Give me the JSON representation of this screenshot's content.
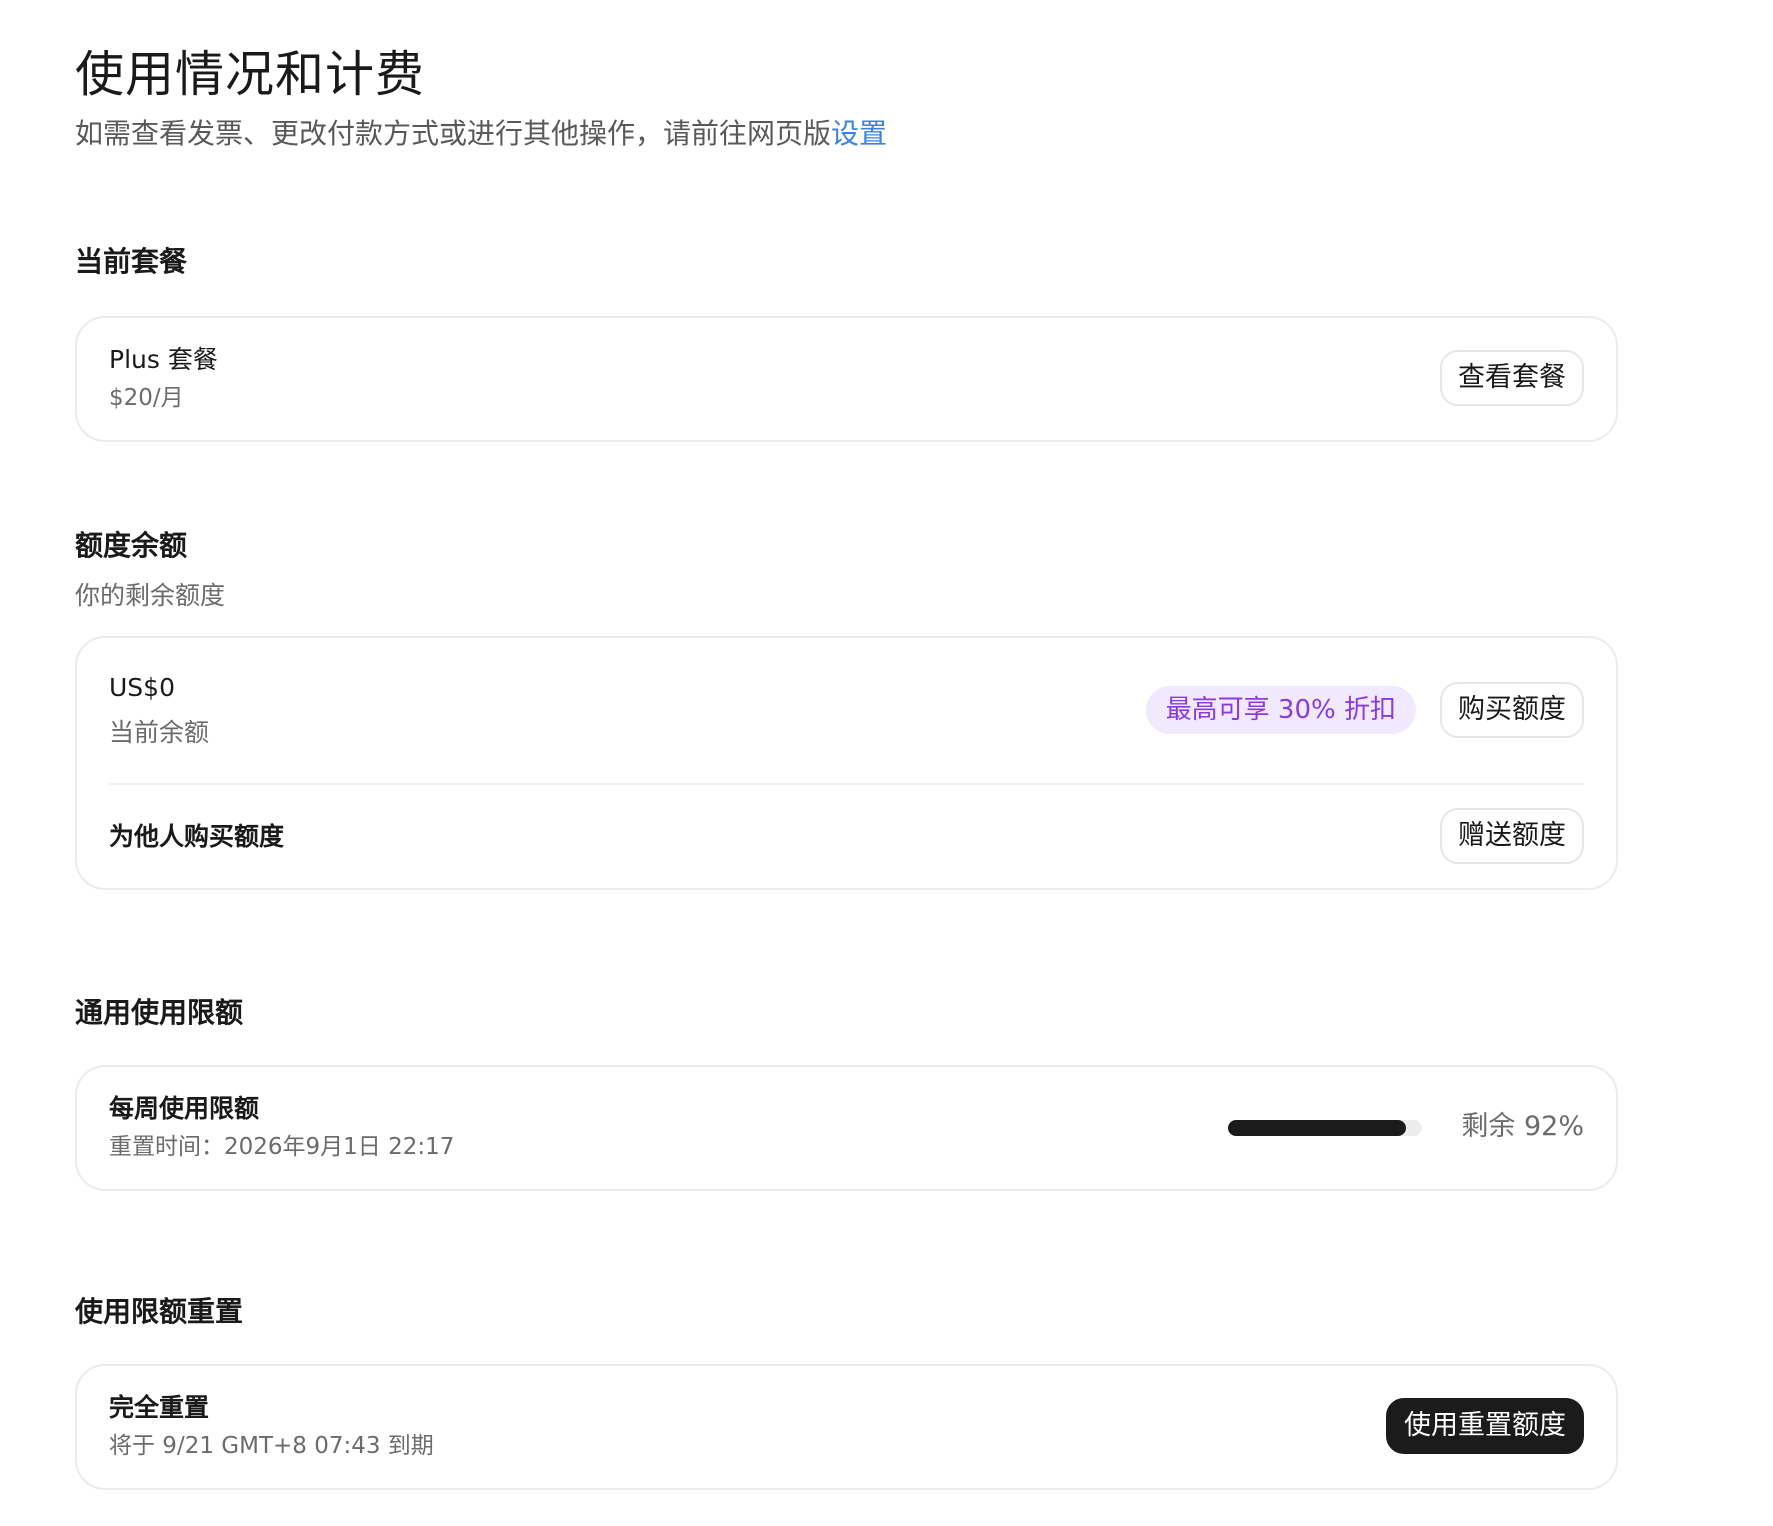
{
  "header": {
    "title": "使用情况和计费",
    "subtitle_prefix": "如需查看发票、更改付款方式或进行其他操作，请前往网页版",
    "subtitle_link": "设置"
  },
  "current_plan": {
    "section_title": "当前套餐",
    "plan_name": "Plus 套餐",
    "plan_price": "$20/月",
    "view_plans_button": "查看套餐"
  },
  "credit_balance": {
    "section_title": "额度余额",
    "section_desc": "你的剩余额度",
    "amount": "US$0",
    "amount_label": "当前余额",
    "discount_badge": "最高可享 30% 折扣",
    "buy_button": "购买额度",
    "gift_label": "为他人购买额度",
    "gift_button": "赠送额度"
  },
  "usage_limits": {
    "section_title": "通用使用限额",
    "weekly_title": "每周使用限额",
    "reset_time": "重置时间：2026年9月1日 22:17",
    "remaining_label": "剩余 92%",
    "remaining_fraction": 0.92
  },
  "limit_reset": {
    "section_title": "使用限额重置",
    "full_reset_title": "完全重置",
    "expiry": "将于 9/21 GMT+8 07:43 到期",
    "use_button": "使用重置额度"
  }
}
